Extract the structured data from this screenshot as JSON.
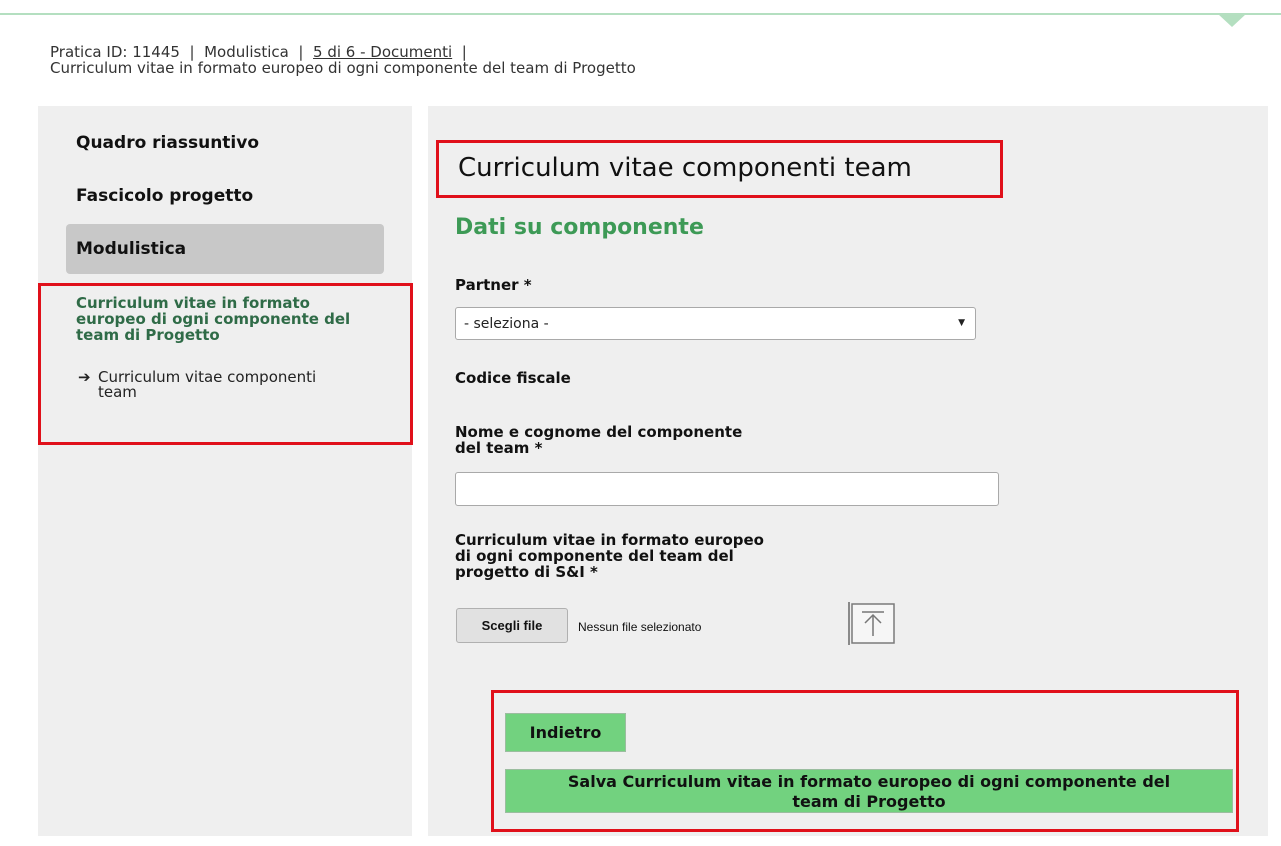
{
  "breadcrumb": {
    "pratica": "Pratica ID: 11445",
    "sep1": "|",
    "modulistica": "Modulistica",
    "sep2": "|",
    "step": "5 di 6 - Documenti",
    "sep3": "|",
    "document": "Curriculum vitae in formato europeo di ogni componente del team di Progetto"
  },
  "sidebar": {
    "items": [
      {
        "label": "Quadro riassuntivo"
      },
      {
        "label": "Fascicolo progetto"
      },
      {
        "label": "Modulistica"
      }
    ],
    "active": "Modulistica",
    "submenu_title": "Curriculum vitae in formato europeo di ogni componente del team di Progetto",
    "submenu_link": "Curriculum vitae componenti team"
  },
  "main": {
    "title": "Curriculum vitae componenti team",
    "section_title": "Dati su componente",
    "partner_label": "Partner *",
    "partner_value": "- seleziona -",
    "codice_fiscale_label": "Codice fiscale",
    "nome_label_1": "Nome e cognome del componente",
    "nome_label_2": "del team *",
    "nome_value": "",
    "cv_label_1": "Curriculum vitae in formato europeo",
    "cv_label_2": "di ogni componente del team del",
    "cv_label_3": "progetto di S&I *",
    "file_button": "Scegli file",
    "file_status": "Nessun file selezionato",
    "back_button": "Indietro",
    "save_button_1": "Salva Curriculum vitae in formato europeo di ogni componente del",
    "save_button_2": "team di Progetto"
  },
  "icons": {
    "upload": "upload-icon",
    "arrow": "arrow-right-icon",
    "caret": "chevron-down-icon"
  },
  "colors": {
    "accent_green": "#3d9a56",
    "button_green": "#72d27f",
    "highlight_red": "#e0101a"
  }
}
